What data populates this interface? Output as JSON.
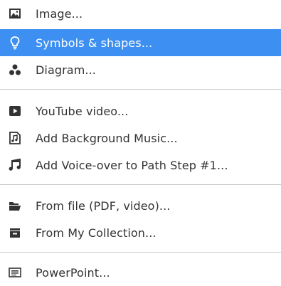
{
  "menu": {
    "highlight_color": "#3d8ff2",
    "items": [
      {
        "label": "Image...",
        "icon": "image-icon"
      },
      {
        "label": "Symbols & shapes...",
        "icon": "lightbulb-icon",
        "selected": true
      },
      {
        "label": "Diagram...",
        "icon": "diagram-icon"
      },
      {
        "label": "YouTube video...",
        "icon": "play-icon"
      },
      {
        "label": "Add Background Music...",
        "icon": "music-file-icon"
      },
      {
        "label": "Add Voice-over to Path Step #1...",
        "icon": "music-note-icon"
      },
      {
        "label": "From file (PDF, video)...",
        "icon": "folder-open-icon"
      },
      {
        "label": "From My Collection...",
        "icon": "collection-icon"
      },
      {
        "label": "PowerPoint...",
        "icon": "powerpoint-icon"
      }
    ]
  }
}
